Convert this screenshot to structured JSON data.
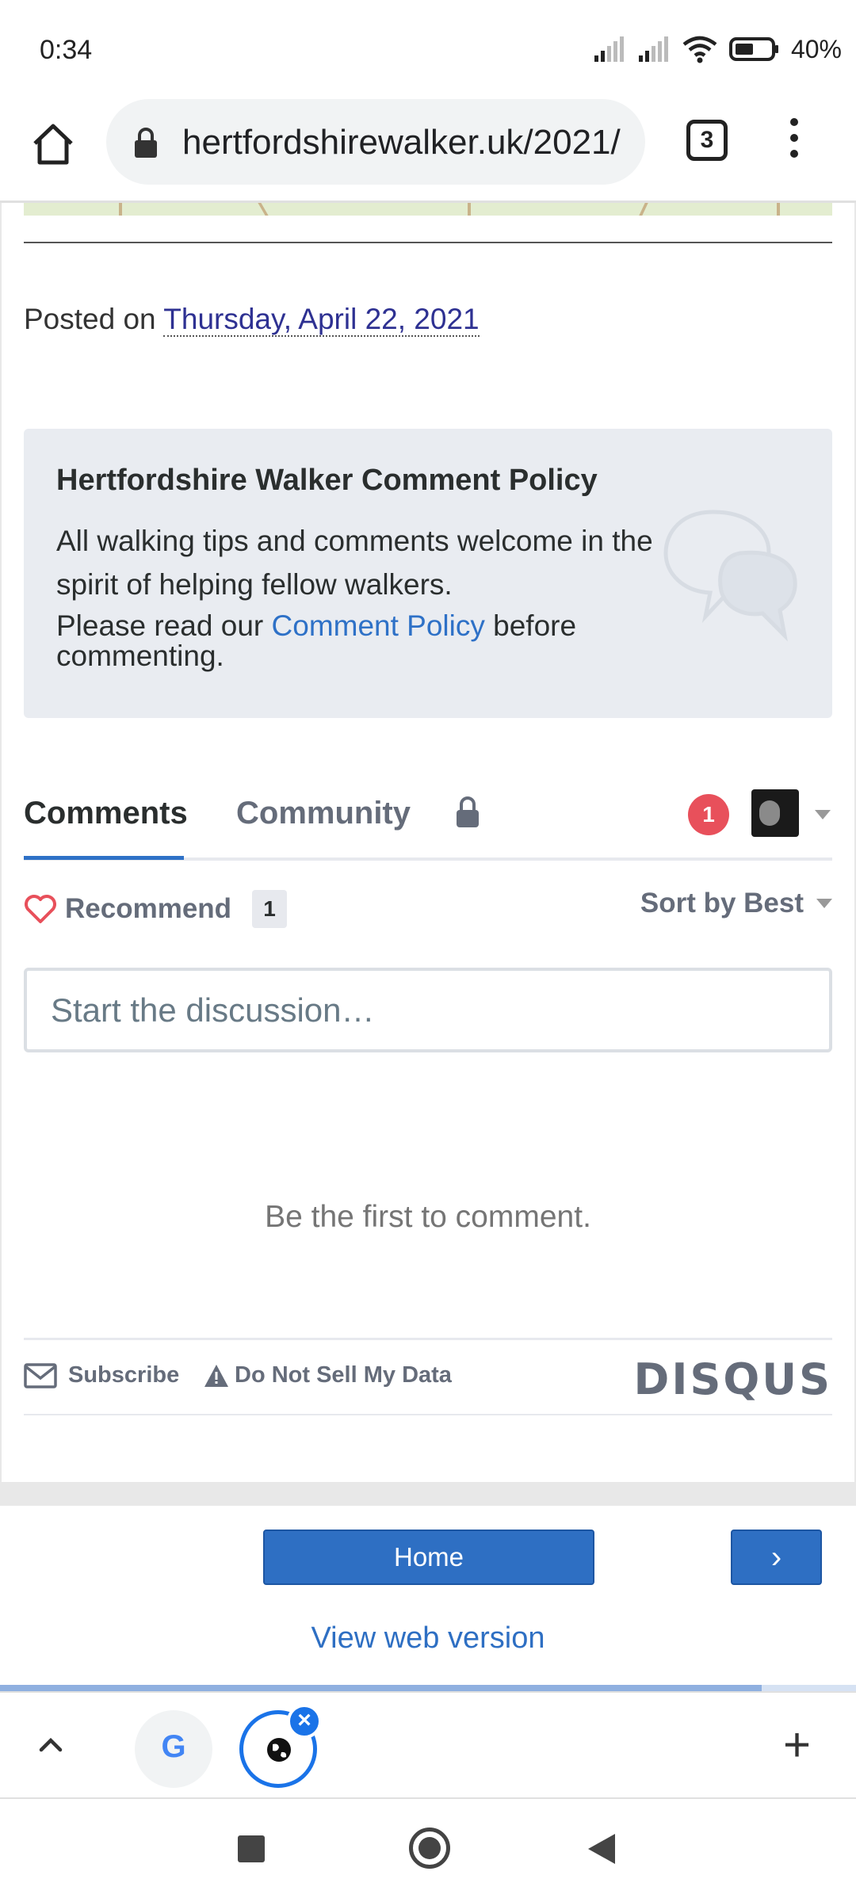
{
  "status_bar": {
    "time": "0:34",
    "battery_percent": "40%"
  },
  "browser": {
    "url": "hertfordshirewalker.uk/2021/",
    "tab_count": "3"
  },
  "article": {
    "posted_prefix": "Posted on",
    "posted_date": "Thursday, April 22, 2021"
  },
  "policy": {
    "title": "Hertfordshire Walker Comment Policy",
    "body": "All walking tips and comments welcome in the spirit of helping fellow walkers.",
    "read_prefix": "Please read our",
    "link_text": "Comment Policy",
    "read_suffix": "before commenting."
  },
  "comments": {
    "tab_comments": "Comments",
    "tab_community": "Community",
    "notification_count": "1",
    "recommend_label": "Recommend",
    "recommend_count": "1",
    "sort_label": "Sort by Best",
    "input_placeholder": "Start the discussion…",
    "empty_message": "Be the first to comment.",
    "subscribe_label": "Subscribe",
    "do_not_sell_label": "Do Not Sell My Data",
    "brand": "DISQUS"
  },
  "footer": {
    "home_label": "Home",
    "next_label": "›",
    "web_version_label": "View web version"
  },
  "page_load_progress": 0.89,
  "tab_strip": {
    "google_tab_icon": "G",
    "close_label": "×",
    "new_tab_label": "+"
  },
  "colors": {
    "accent": "#2e71c7",
    "badge": "#e8505b",
    "recommend_heart": "#e8505b"
  }
}
